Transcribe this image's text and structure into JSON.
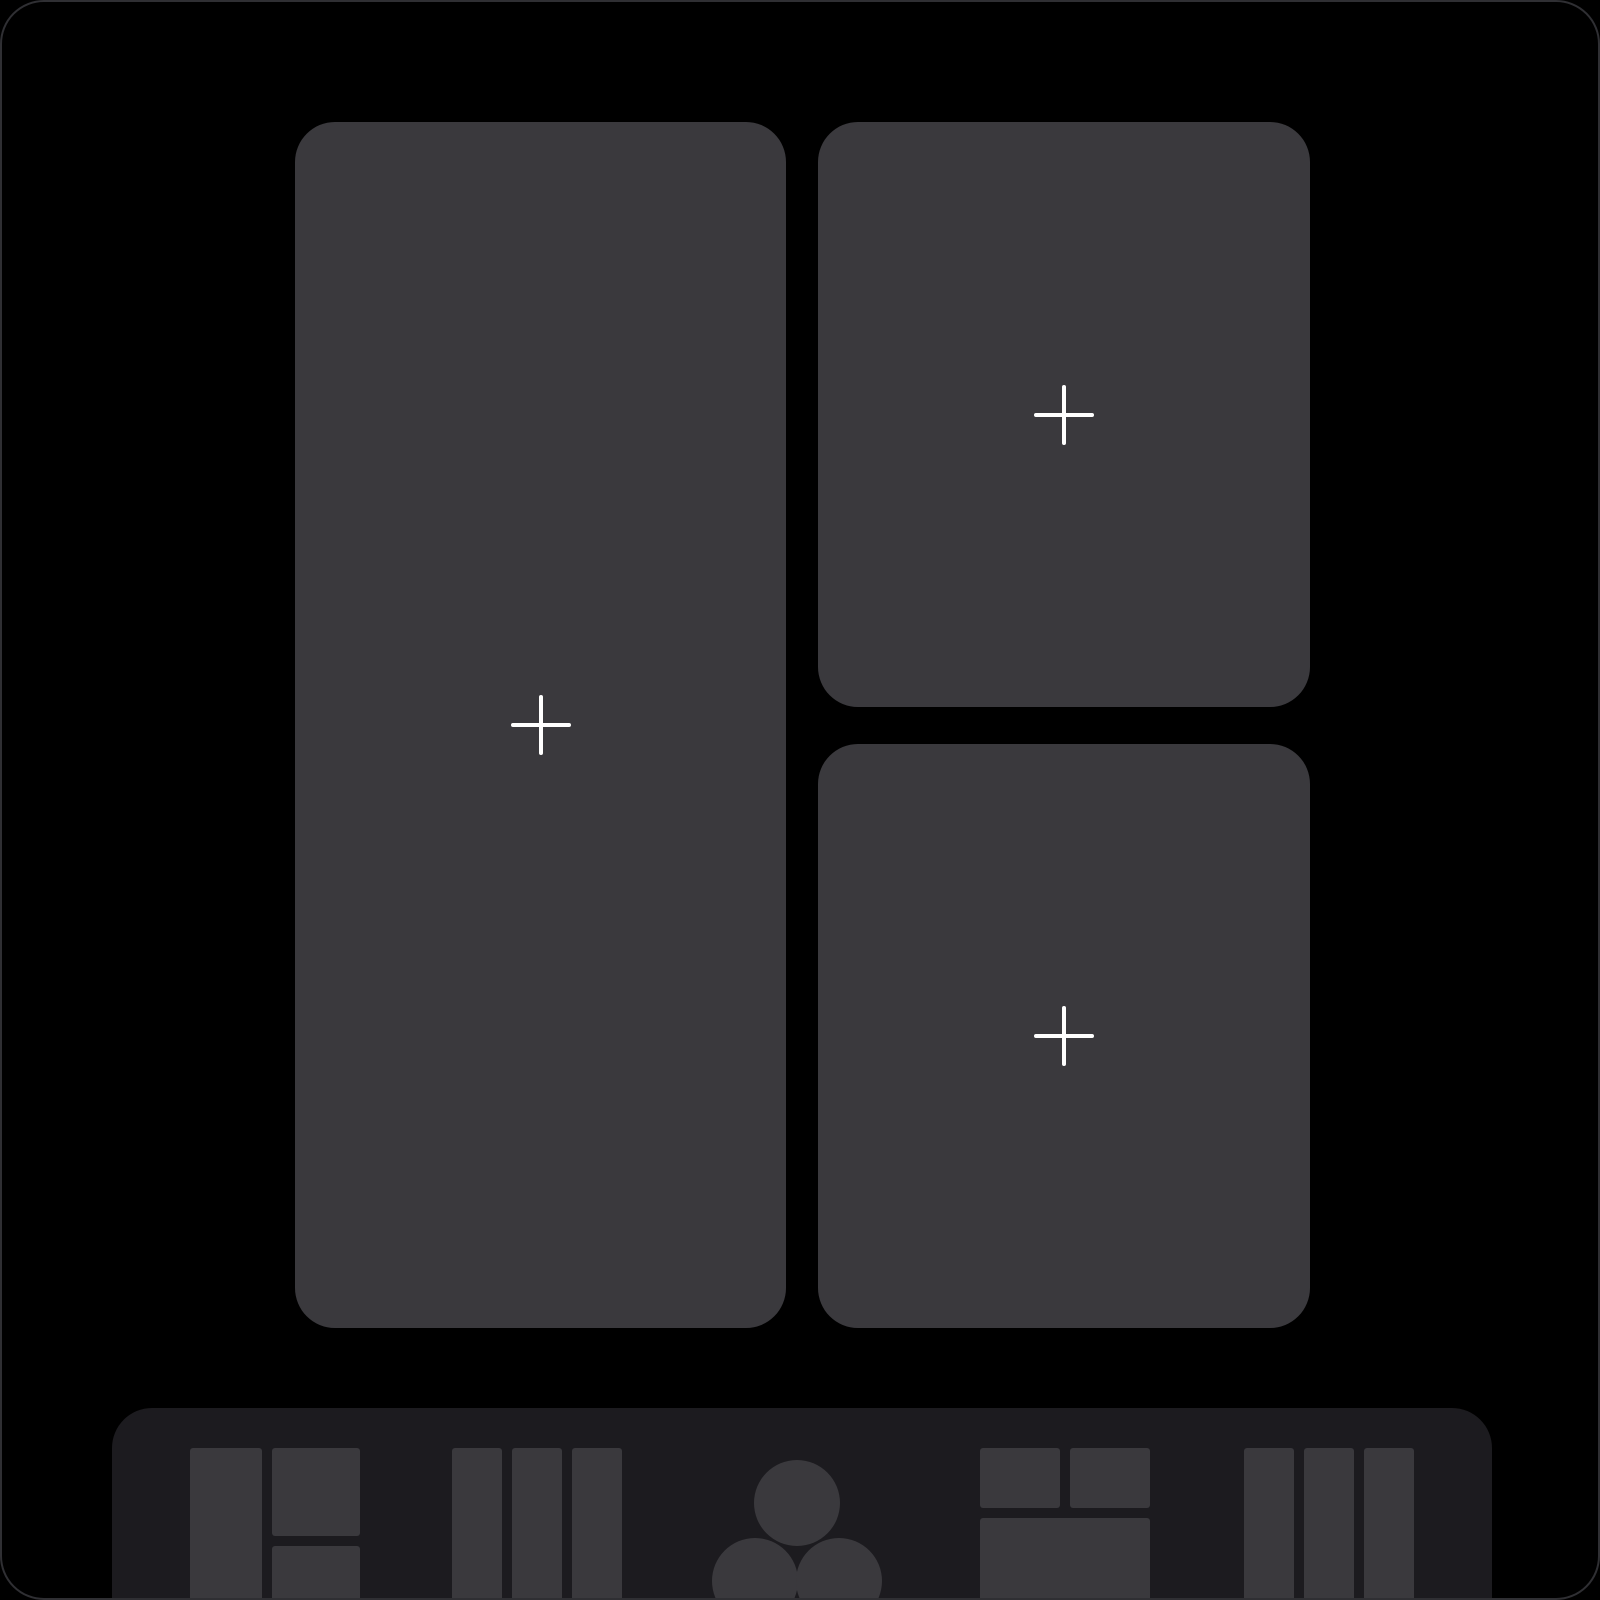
{
  "editor": {
    "slots": [
      {
        "name": "slot-left",
        "action": "add"
      },
      {
        "name": "slot-top-right",
        "action": "add"
      },
      {
        "name": "slot-bottom-right",
        "action": "add"
      }
    ]
  },
  "layout_tray": {
    "options": [
      {
        "name": "layout-one-left-two-right-icon"
      },
      {
        "name": "layout-three-columns-icon"
      },
      {
        "name": "layout-three-circles-icon"
      },
      {
        "name": "layout-two-top-one-bottom-icon"
      },
      {
        "name": "layout-three-columns-alt-icon"
      }
    ]
  },
  "colors": {
    "background": "#000000",
    "slot": "#3a393d",
    "tray": "#1c1b1f",
    "icon": "#ffffff"
  }
}
